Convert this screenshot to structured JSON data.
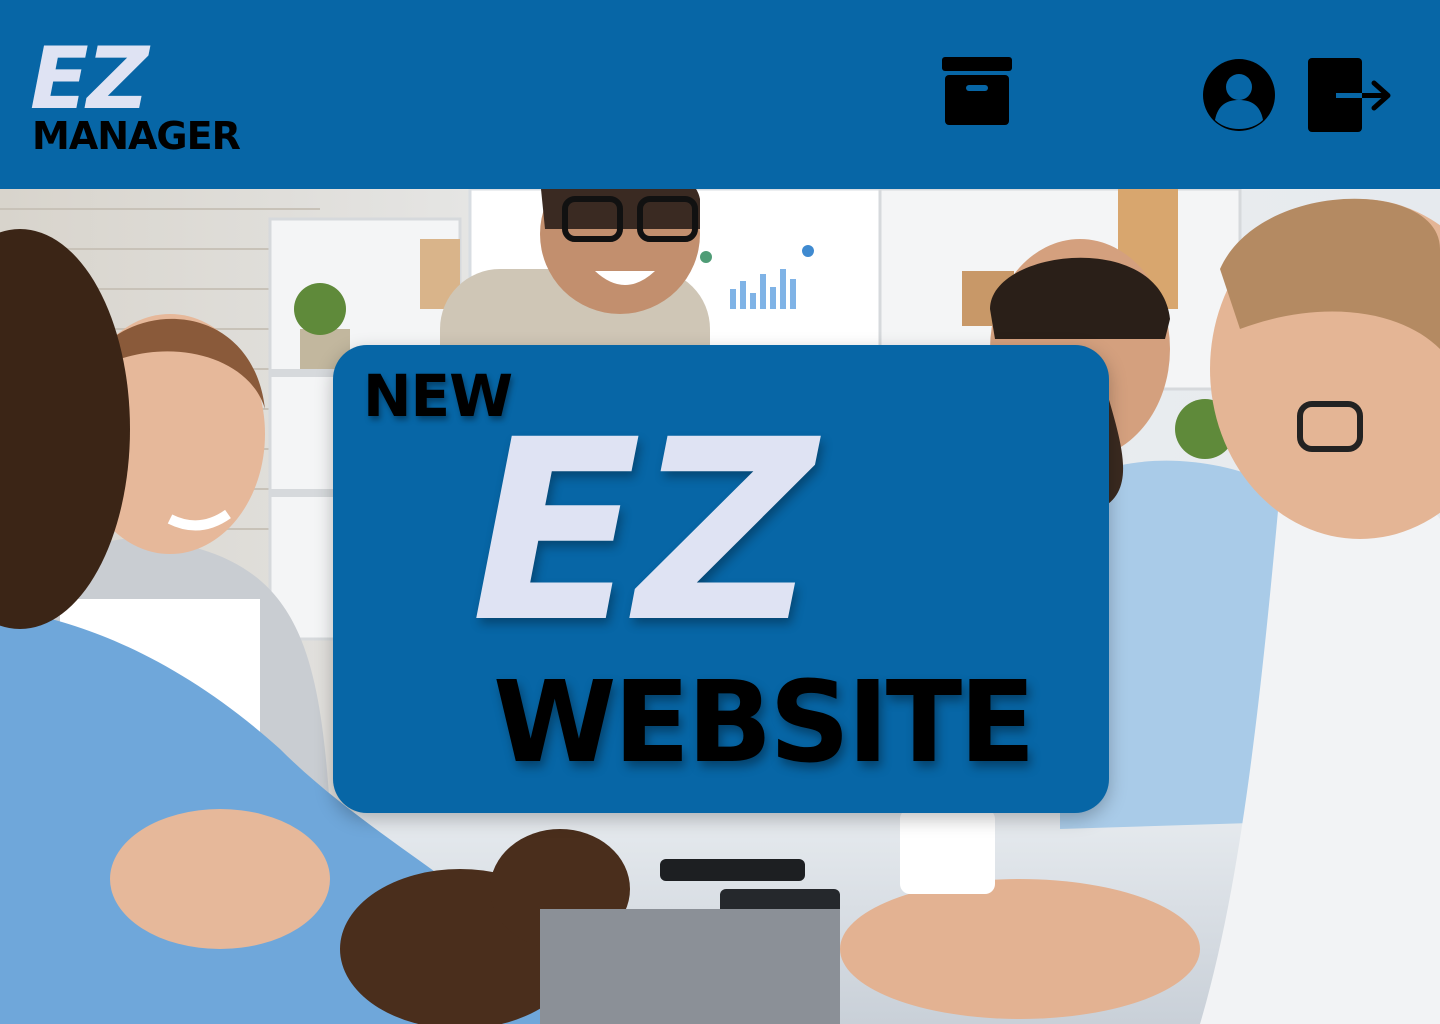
{
  "header": {
    "logo": {
      "primary": "EZ",
      "secondary": "MANAGER"
    },
    "icons": [
      "archive-box-icon",
      "user-profile-icon",
      "logout-icon"
    ]
  },
  "hero": {
    "image": "office-meeting-photo"
  },
  "promo": {
    "line1": "NEW",
    "line2": "EZ",
    "line3": "WEBSITE"
  },
  "colors": {
    "brand_blue": "#0766a6",
    "logo_light": "#dfe3f3",
    "text_dark": "#000000"
  }
}
